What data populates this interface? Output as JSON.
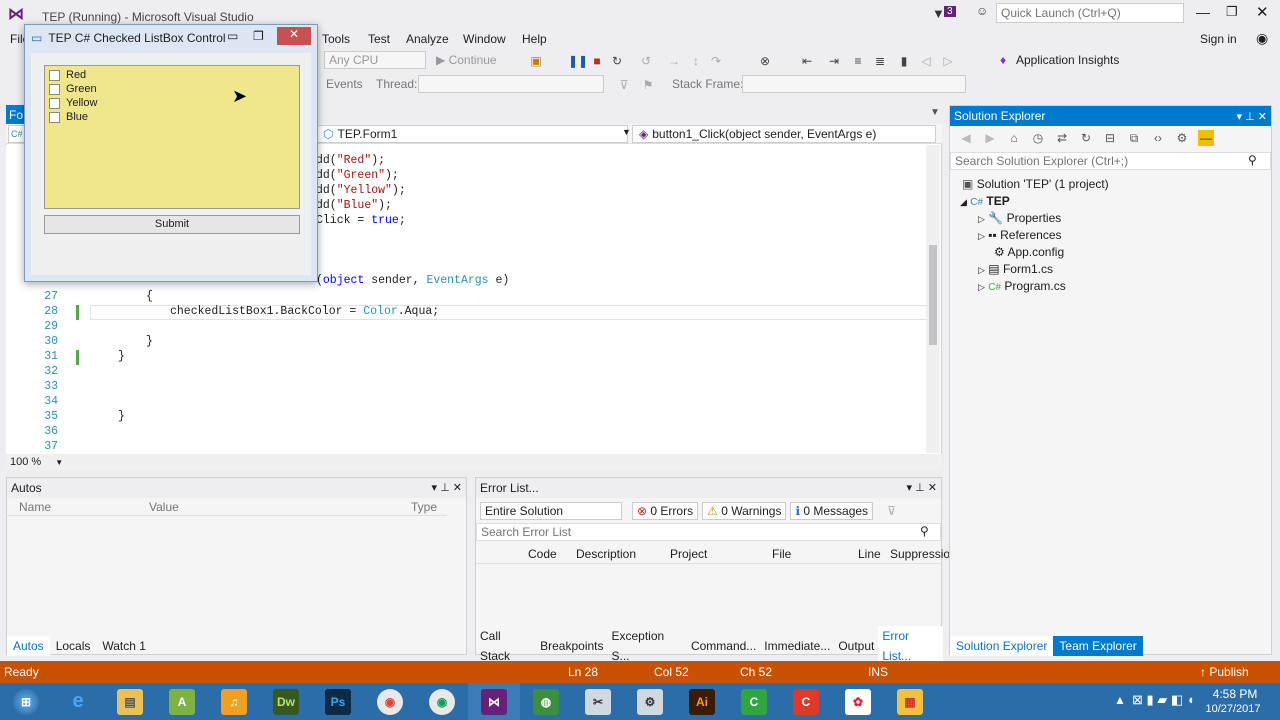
{
  "window": {
    "title": "TEP (Running) - Microsoft Visual Studio"
  },
  "quick_launch": {
    "placeholder": "Quick Launch (Ctrl+Q)"
  },
  "notifications": {
    "count": "3"
  },
  "menu": {
    "items": [
      "File",
      "Tools",
      "Test",
      "Analyze",
      "Window",
      "Help"
    ],
    "sign_in": "Sign in"
  },
  "toolbar": {
    "platform": "Any CPU",
    "continue": "Continue",
    "app_insights": "Application Insights"
  },
  "toolbar2": {
    "events": "Events",
    "thread": "Thread:",
    "stack_frame": "Stack Frame:"
  },
  "form": {
    "title": "TEP C# Checked ListBox Control",
    "items": [
      "Red",
      "Green",
      "Yellow",
      "Blue"
    ],
    "submit": "Submit",
    "listbox_color": "#f0e68c"
  },
  "editor": {
    "tab_partial": "Fo",
    "nav_left": "TEP.Form1",
    "nav_right": "button1_Click(object sender, EventArgs e)",
    "zoom": "100 %",
    "lines": [
      {
        "n": "",
        "code": "dd(\"Red\");"
      },
      {
        "n": "",
        "code": "dd(\"Green\");"
      },
      {
        "n": "",
        "code": "dd(\"Yellow\");"
      },
      {
        "n": "",
        "code": "dd(\"Blue\");"
      },
      {
        "n": "",
        "code": "Click = true;"
      },
      {
        "n": "",
        "code": ""
      },
      {
        "n": "",
        "code": ""
      },
      {
        "n": "",
        "code": "(object sender, EventArgs e)"
      },
      {
        "n": "27",
        "code": "        {"
      },
      {
        "n": "28",
        "code": "            checkedListBox1.BackColor = Color.Aqua;"
      },
      {
        "n": "29",
        "code": ""
      },
      {
        "n": "30",
        "code": "        }"
      },
      {
        "n": "31",
        "code": "    }"
      },
      {
        "n": "32",
        "code": ""
      },
      {
        "n": "33",
        "code": ""
      },
      {
        "n": "34",
        "code": ""
      },
      {
        "n": "35",
        "code": "    }"
      },
      {
        "n": "36",
        "code": ""
      },
      {
        "n": "37",
        "code": ""
      }
    ]
  },
  "autos": {
    "title": "Autos",
    "cols": [
      "Name",
      "Value",
      "Type"
    ],
    "tabs": [
      "Autos",
      "Locals",
      "Watch 1"
    ]
  },
  "errors": {
    "title": "Error List...",
    "scope": "Entire Solution",
    "errors": "0 Errors",
    "warnings": "0 Warnings",
    "messages": "0 Messages",
    "search_placeholder": "Search Error List",
    "cols": [
      "Code",
      "Description",
      "Project",
      "File",
      "Line",
      "Suppressio"
    ],
    "tabs": [
      "Call Stack",
      "Breakpoints",
      "Exception S...",
      "Command...",
      "Immediate...",
      "Output",
      "Error List..."
    ]
  },
  "solution_explorer": {
    "title": "Solution Explorer",
    "search_placeholder": "Search Solution Explorer (Ctrl+;)",
    "solution": "Solution 'TEP' (1 project)",
    "project": "TEP",
    "items": [
      "Properties",
      "References",
      "App.config",
      "Form1.cs",
      "Program.cs"
    ],
    "tabs": [
      "Solution Explorer",
      "Team Explorer"
    ]
  },
  "status": {
    "ready": "Ready",
    "ln": "Ln 28",
    "col": "Col 52",
    "ch": "Ch 52",
    "ins": "INS",
    "publish": "Publish"
  },
  "clock": {
    "time": "4:58 PM",
    "date": "10/27/2017"
  },
  "taskbar": {
    "apps": [
      "Start",
      "IE",
      "Explorer",
      "Android",
      "Audio",
      "Dw",
      "Ps",
      "Chrome",
      "Chrome",
      "VS",
      "Globe",
      "Tool",
      "Gear",
      "Ai",
      "Camtasia",
      "Camtasia",
      "Picasa",
      "Files"
    ]
  }
}
